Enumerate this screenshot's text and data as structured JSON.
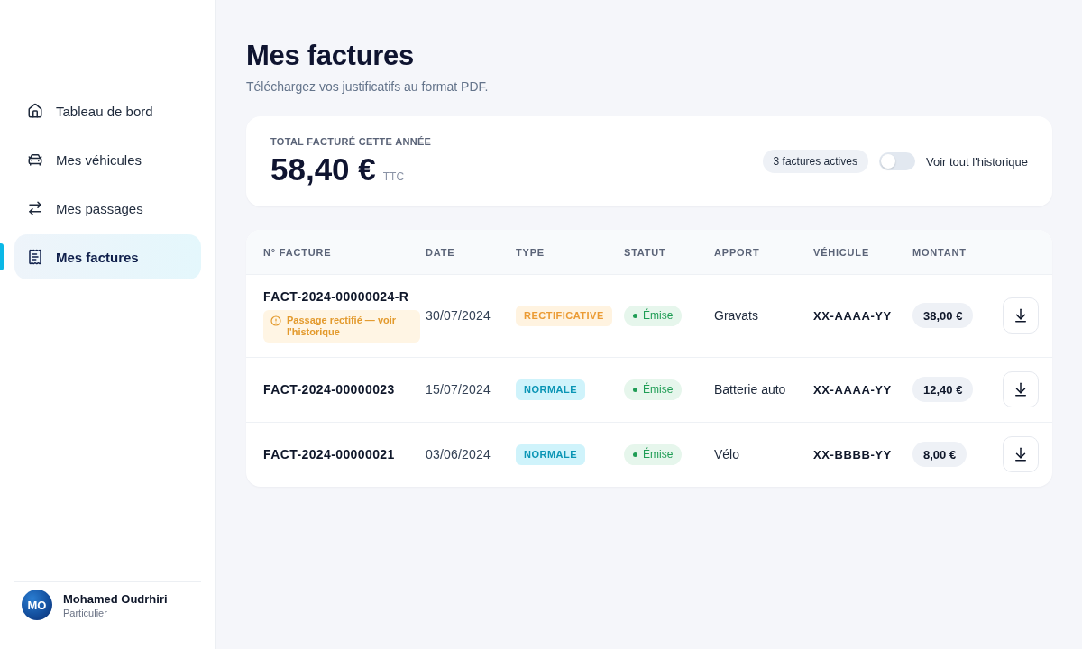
{
  "sidebar": {
    "items": [
      {
        "label": "Tableau de bord",
        "selected": false
      },
      {
        "label": "Mes véhicules",
        "selected": false
      },
      {
        "label": "Mes passages",
        "selected": false
      },
      {
        "label": "Mes factures",
        "selected": true
      }
    ],
    "user": {
      "initials": "MO",
      "name": "Mohamed Oudrhiri",
      "role": "Particulier"
    }
  },
  "page": {
    "title": "Mes factures",
    "subtitle": "Téléchargez vos justificatifs au format PDF."
  },
  "summary": {
    "label": "TOTAL FACTURÉ CETTE ANNÉE",
    "amount": "58,40 €",
    "suffix": "TTC",
    "count_badge": "3 factures actives",
    "history_toggle": {
      "label": "Voir tout l'historique",
      "on": false
    }
  },
  "table": {
    "columns": [
      "N° FACTURE",
      "DATE",
      "TYPE",
      "STATUT",
      "APPORT",
      "VÉHICULE",
      "MONTANT"
    ],
    "rows": [
      {
        "number": "FACT-2024-00000024-R",
        "notice": "Passage rectifié — voir l'historique",
        "date": "30/07/2024",
        "type": {
          "label": "RECTIFICATIVE",
          "kind": "rectificative"
        },
        "status": {
          "label": "Émise",
          "kind": "issued"
        },
        "apport": "Gravats",
        "vehicle": "XX-AAAA-YY",
        "amount": "38,00 €"
      },
      {
        "number": "FACT-2024-00000023",
        "date": "15/07/2024",
        "type": {
          "label": "NORMALE",
          "kind": "normal"
        },
        "status": {
          "label": "Émise",
          "kind": "issued"
        },
        "apport": "Batterie auto",
        "vehicle": "XX-AAAA-YY",
        "amount": "12,40 €"
      },
      {
        "number": "FACT-2024-00000021",
        "date": "03/06/2024",
        "type": {
          "label": "NORMALE",
          "kind": "normal"
        },
        "status": {
          "label": "Émise",
          "kind": "issued"
        },
        "apport": "Vélo",
        "vehicle": "XX-BBBB-YY",
        "amount": "8,00 €"
      }
    ]
  }
}
